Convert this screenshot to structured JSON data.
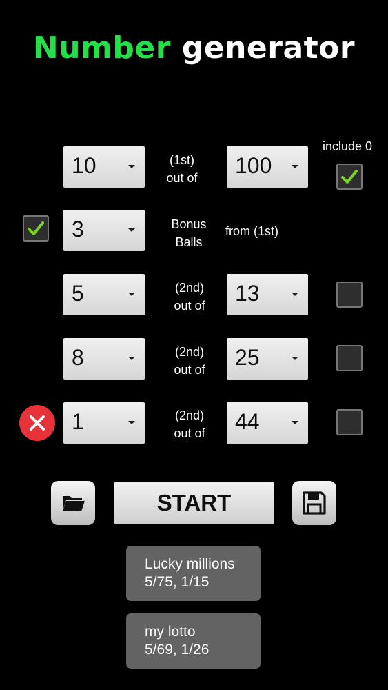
{
  "title": {
    "part1": "Number",
    "part2": "generator"
  },
  "include_zero_label": "include 0",
  "rows": [
    {
      "count": "10",
      "connector_line1": "(1st)",
      "connector_line2": "out of",
      "max": "100",
      "include_zero": true
    },
    {
      "enabled": true,
      "count": "3",
      "label_line1": "Bonus",
      "label_line2": "Balls",
      "source": "from (1st)"
    },
    {
      "count": "5",
      "connector_line1": "(2nd)",
      "connector_line2": "out of",
      "max": "13",
      "include_zero": false
    },
    {
      "count": "8",
      "connector_line1": "(2nd)",
      "connector_line2": "out of",
      "max": "25",
      "include_zero": false
    },
    {
      "count": "1",
      "connector_line1": "(2nd)",
      "connector_line2": "out of",
      "max": "44",
      "include_zero": false
    }
  ],
  "actions": {
    "start_label": "START",
    "open_icon": "folder-icon",
    "save_icon": "save-icon"
  },
  "presets": [
    {
      "name": "Lucky millions",
      "config": "5/75, 1/15"
    },
    {
      "name": "my lotto",
      "config": "5/69, 1/26"
    }
  ],
  "colors": {
    "title_accent": "#22e048",
    "check": "#7ed321",
    "remove": "#e8323a"
  }
}
